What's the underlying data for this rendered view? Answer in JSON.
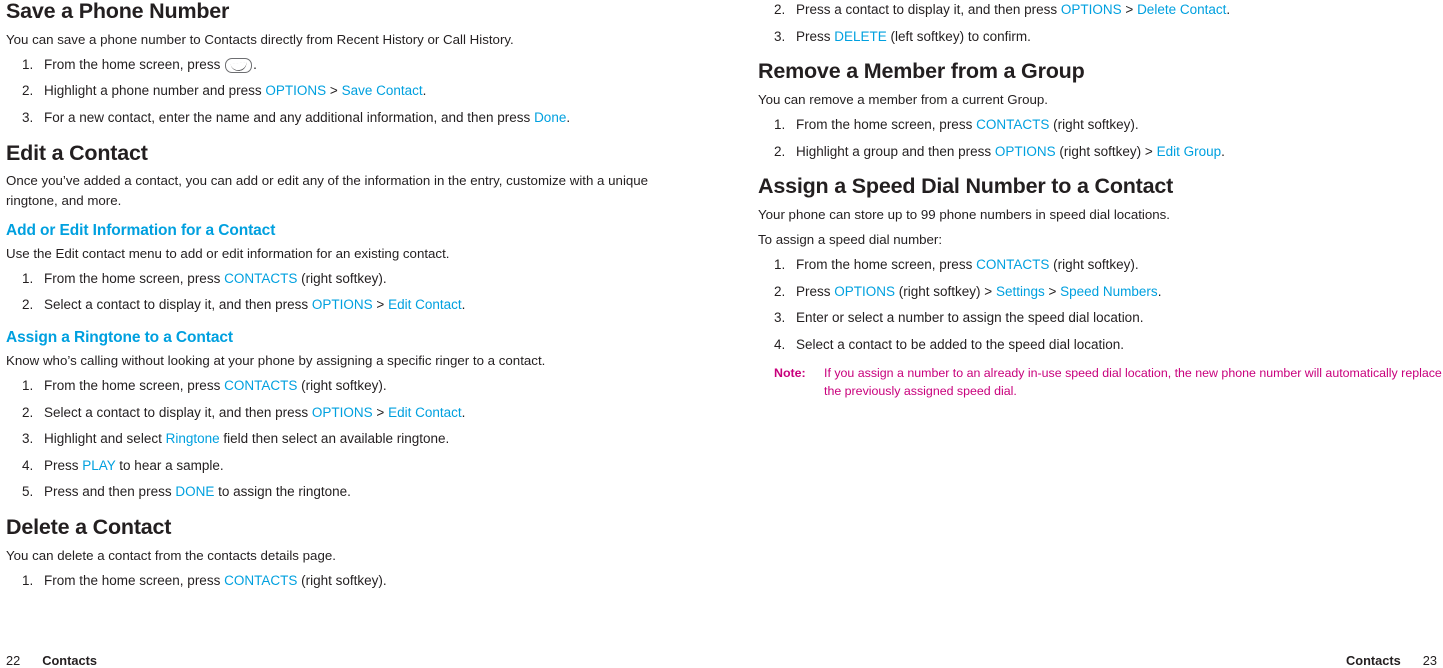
{
  "left_column": {
    "sections": [
      {
        "heading": "Save a Phone Number",
        "intro": "You can save a phone number to Contacts directly from Recent History or Call History.",
        "steps": [
          {
            "parts": [
              {
                "t": "From the home screen, press ",
                "c": "black"
              },
              {
                "t": "",
                "c": "icon-phone-key"
              },
              {
                "t": ".",
                "c": "black"
              }
            ]
          },
          {
            "parts": [
              {
                "t": "Highlight a phone number and press ",
                "c": "black"
              },
              {
                "t": "OPTIONS",
                "c": "blue"
              },
              {
                "t": " > ",
                "c": "black"
              },
              {
                "t": "Save Contact",
                "c": "blue"
              },
              {
                "t": ".",
                "c": "black"
              }
            ]
          },
          {
            "parts": [
              {
                "t": "For a new contact, enter the name and any additional information, and then press ",
                "c": "black"
              },
              {
                "t": "Done",
                "c": "blue"
              },
              {
                "t": ".",
                "c": "black"
              }
            ]
          }
        ]
      },
      {
        "heading": "Edit a Contact",
        "intro": "Once you’ve added a contact, you can add or edit any of the information in the entry, customize with a unique ringtone, and more.",
        "steps": []
      }
    ],
    "subsections": [
      {
        "heading": "Add or Edit Information for a Contact",
        "intro": "Use the Edit contact menu to add or edit information for an existing contact.",
        "steps": [
          {
            "parts": [
              {
                "t": "From the home screen, press ",
                "c": "black"
              },
              {
                "t": "CONTACTS",
                "c": "blue"
              },
              {
                "t": " (right softkey).",
                "c": "black"
              }
            ]
          },
          {
            "parts": [
              {
                "t": "Select a contact to display it, and then press ",
                "c": "black"
              },
              {
                "t": "OPTIONS",
                "c": "blue"
              },
              {
                "t": " > ",
                "c": "black"
              },
              {
                "t": "Edit Contact",
                "c": "blue"
              },
              {
                "t": ".",
                "c": "black"
              }
            ]
          }
        ]
      },
      {
        "heading": "Assign a Ringtone to a Contact",
        "intro": "Know who’s calling without looking at your phone by assigning a specific ringer to a contact.",
        "steps": [
          {
            "parts": [
              {
                "t": "From the home screen, press ",
                "c": "black"
              },
              {
                "t": "CONTACTS",
                "c": "blue"
              },
              {
                "t": " (right softkey).",
                "c": "black"
              }
            ]
          },
          {
            "parts": [
              {
                "t": "Select a contact to display it, and then press ",
                "c": "black"
              },
              {
                "t": "OPTIONS",
                "c": "blue"
              },
              {
                "t": " > ",
                "c": "black"
              },
              {
                "t": "Edit Contact",
                "c": "blue"
              },
              {
                "t": ".",
                "c": "black"
              }
            ]
          },
          {
            "parts": [
              {
                "t": "Highlight and select ",
                "c": "black"
              },
              {
                "t": "Ringtone",
                "c": "blue"
              },
              {
                "t": " field then select an available ringtone.",
                "c": "black"
              }
            ]
          },
          {
            "parts": [
              {
                "t": "Press ",
                "c": "black"
              },
              {
                "t": "PLAY",
                "c": "blue"
              },
              {
                "t": " to hear a sample.",
                "c": "black"
              }
            ]
          },
          {
            "parts": [
              {
                "t": "Press and then press ",
                "c": "black"
              },
              {
                "t": "DONE",
                "c": "blue"
              },
              {
                "t": " to assign the ringtone.",
                "c": "black"
              }
            ]
          }
        ]
      }
    ],
    "last_section": {
      "heading": "Delete a Contact",
      "intro": "You can delete a contact from the contacts details page.",
      "steps": [
        {
          "parts": [
            {
              "t": "From the home screen, press ",
              "c": "black"
            },
            {
              "t": "CONTACTS",
              "c": "blue"
            },
            {
              "t": " (right softkey).",
              "c": "black"
            }
          ]
        }
      ]
    }
  },
  "right_column": {
    "continued_steps": {
      "start": 2,
      "items": [
        {
          "parts": [
            {
              "t": "Press a contact to display it, and then press ",
              "c": "black"
            },
            {
              "t": "OPTIONS",
              "c": "blue"
            },
            {
              "t": " > ",
              "c": "black"
            },
            {
              "t": "Delete Contact",
              "c": "blue"
            },
            {
              "t": ".",
              "c": "black"
            }
          ]
        },
        {
          "parts": [
            {
              "t": "Press ",
              "c": "black"
            },
            {
              "t": "DELETE",
              "c": "blue"
            },
            {
              "t": " (left softkey) to confirm.",
              "c": "black"
            }
          ]
        }
      ]
    },
    "subsections": [
      {
        "heading": "Remove a Member from a Group",
        "intro": "You can remove a member from a current Group.",
        "steps": [
          {
            "parts": [
              {
                "t": "From the home screen, press ",
                "c": "black"
              },
              {
                "t": "CONTACTS",
                "c": "blue"
              },
              {
                "t": " (right softkey).",
                "c": "black"
              }
            ]
          },
          {
            "parts": [
              {
                "t": "Highlight a group and then press ",
                "c": "black"
              },
              {
                "t": "OPTIONS",
                "c": "blue"
              },
              {
                "t": " (right softkey) > ",
                "c": "black"
              },
              {
                "t": "Edit Group",
                "c": "blue"
              },
              {
                "t": ".",
                "c": "black"
              }
            ]
          }
        ]
      },
      {
        "heading": "Assign a Speed Dial Number to a Contact",
        "intro": "Your phone can store up to 99 phone numbers in speed dial locations.",
        "intro2": "To assign a speed dial number:",
        "steps": [
          {
            "parts": [
              {
                "t": "From the home screen, press ",
                "c": "black"
              },
              {
                "t": "CONTACTS",
                "c": "blue"
              },
              {
                "t": " (right softkey).",
                "c": "black"
              }
            ]
          },
          {
            "parts": [
              {
                "t": "Press ",
                "c": "black"
              },
              {
                "t": "OPTIONS",
                "c": "blue"
              },
              {
                "t": " (right softkey) > ",
                "c": "black"
              },
              {
                "t": "Settings",
                "c": "blue"
              },
              {
                "t": " > ",
                "c": "black"
              },
              {
                "t": "Speed Numbers",
                "c": "blue"
              },
              {
                "t": ".",
                "c": "black"
              }
            ]
          },
          {
            "parts": [
              {
                "t": "Enter or select a number to assign the speed dial location.",
                "c": "black"
              }
            ]
          },
          {
            "parts": [
              {
                "t": "Select a contact to be added to the speed dial location.",
                "c": "black"
              }
            ]
          }
        ]
      }
    ],
    "note": {
      "label": "Note:",
      "text": "If you assign a number to an already in-use speed dial location, the new phone number will automatically replace the previously assigned speed dial."
    }
  },
  "footers": {
    "left": {
      "page": "22",
      "chapter": "Contacts"
    },
    "right": {
      "chapter": "Contacts",
      "page": "23"
    }
  },
  "colors": {
    "accent_blue": "#00a0df",
    "note_magenta": "#c8007c",
    "body_black": "#231f20"
  }
}
